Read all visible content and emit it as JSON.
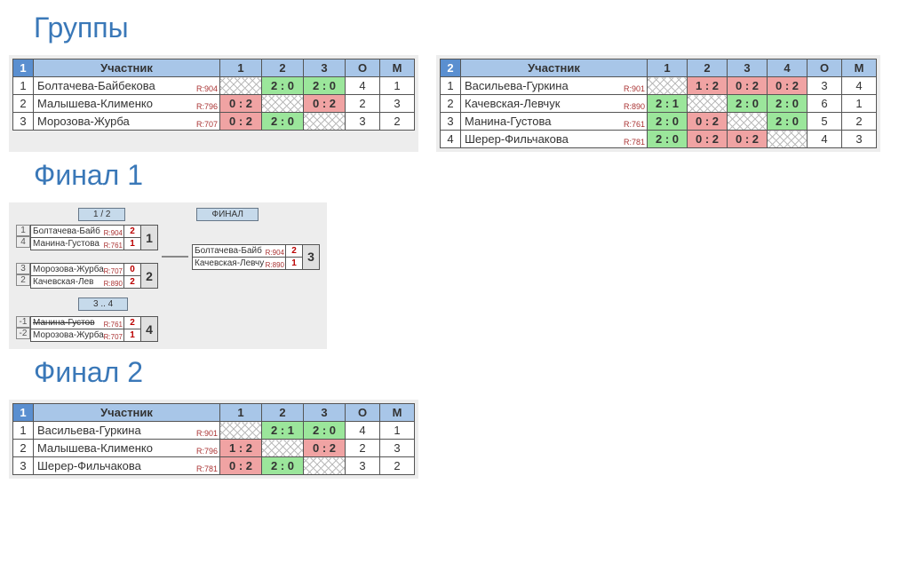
{
  "headings": {
    "groups": "Группы",
    "final1": "Финал 1",
    "final2": "Финал 2"
  },
  "labels": {
    "participant": "Участник",
    "o": "О",
    "m": "М"
  },
  "group1": {
    "num": "1",
    "cols": [
      "1",
      "2",
      "3"
    ],
    "rows": [
      {
        "n": "1",
        "name": "Болтачева-Байбекова",
        "r": "R:904",
        "cells": [
          "self",
          "2 : 0 win",
          "2 : 0 win"
        ],
        "o": "4",
        "m": "1"
      },
      {
        "n": "2",
        "name": "Малышева-Клименко",
        "r": "R:796",
        "cells": [
          "0 : 2 lose",
          "self",
          "0 : 2 lose"
        ],
        "o": "2",
        "m": "3"
      },
      {
        "n": "3",
        "name": "Морозова-Журба",
        "r": "R:707",
        "cells": [
          "0 : 2 lose",
          "2 : 0 win",
          "self"
        ],
        "o": "3",
        "m": "2"
      }
    ]
  },
  "group2": {
    "num": "2",
    "cols": [
      "1",
      "2",
      "3",
      "4"
    ],
    "rows": [
      {
        "n": "1",
        "name": "Васильева-Гуркина",
        "r": "R:901",
        "cells": [
          "self",
          "1 : 2 lose",
          "0 : 2 lose",
          "0 : 2 lose"
        ],
        "o": "3",
        "m": "4"
      },
      {
        "n": "2",
        "name": "Качевская-Левчук",
        "r": "R:890",
        "cells": [
          "2 : 1 win",
          "self",
          "2 : 0 win",
          "2 : 0 win"
        ],
        "o": "6",
        "m": "1"
      },
      {
        "n": "3",
        "name": "Манина-Густова",
        "r": "R:761",
        "cells": [
          "2 : 0 win",
          "0 : 2 lose",
          "self",
          "2 : 0 win"
        ],
        "o": "5",
        "m": "2"
      },
      {
        "n": "4",
        "name": "Шерер-Фильчакова",
        "r": "R:781",
        "cells": [
          "2 : 0 win",
          "0 : 2 lose",
          "0 : 2 lose",
          "self"
        ],
        "o": "4",
        "m": "3"
      }
    ]
  },
  "bracket": {
    "semi_label": "1 / 2",
    "final_label": "ФИНАЛ",
    "third_label": "3 .. 4",
    "semi": [
      {
        "idx": [
          "1",
          "4"
        ],
        "p": [
          {
            "n": "Болтачева-Байб",
            "r": "R:904",
            "s": "2"
          },
          {
            "n": "Манина-Густова",
            "r": "R:761",
            "s": "1"
          }
        ],
        "place": "1"
      },
      {
        "idx": [
          "3",
          "2"
        ],
        "p": [
          {
            "n": "Морозова-Журба",
            "r": "R:707",
            "s": "0"
          },
          {
            "n": "Качевская-Лев",
            "r": "R:890",
            "s": "2"
          }
        ],
        "place": "2"
      }
    ],
    "final": {
      "p": [
        {
          "n": "Болтачева-Байб",
          "r": "R:904",
          "s": "2"
        },
        {
          "n": "Качевская-Левчу",
          "r": "R:890",
          "s": "1"
        }
      ],
      "place": "3"
    },
    "third": {
      "idx": [
        "-1",
        "-2"
      ],
      "p": [
        {
          "n": "Манина-Густов",
          "r": "R:761",
          "s": "2",
          "strike": true
        },
        {
          "n": "Морозова-Журба",
          "r": "R:707",
          "s": "1"
        }
      ],
      "place": "4"
    }
  },
  "final2": {
    "num": "1",
    "cols": [
      "1",
      "2",
      "3"
    ],
    "rows": [
      {
        "n": "1",
        "name": "Васильева-Гуркина",
        "r": "R:901",
        "cells": [
          "self",
          "2 : 1 win",
          "2 : 0 win"
        ],
        "o": "4",
        "m": "1"
      },
      {
        "n": "2",
        "name": "Малышева-Клименко",
        "r": "R:796",
        "cells": [
          "1 : 2 lose",
          "self",
          "0 : 2 lose"
        ],
        "o": "2",
        "m": "3"
      },
      {
        "n": "3",
        "name": "Шерер-Фильчакова",
        "r": "R:781",
        "cells": [
          "0 : 2 lose",
          "2 : 0 win",
          "self"
        ],
        "o": "3",
        "m": "2"
      }
    ]
  }
}
